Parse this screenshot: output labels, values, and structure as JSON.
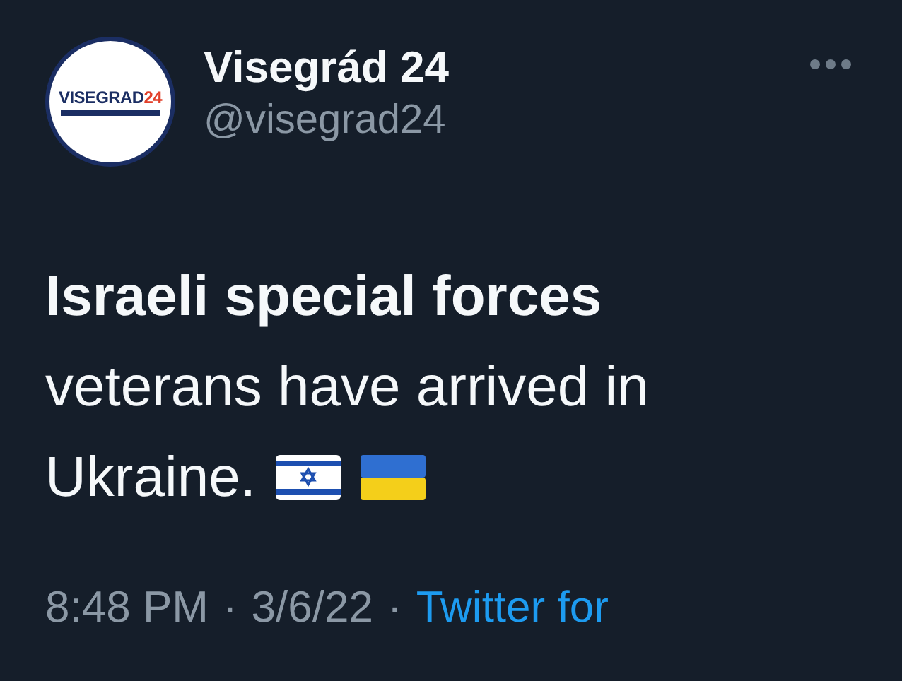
{
  "tweet": {
    "author": {
      "name": "Visegrád 24",
      "handle": "@visegrad24",
      "avatar": {
        "wordmark": "VISEGRAD",
        "number": "24"
      }
    },
    "headline": "Israeli special forces",
    "body_lines": [
      "veterans have arrived in",
      "Ukraine."
    ],
    "flags": [
      {
        "kind": "israel"
      },
      {
        "kind": "ukraine"
      }
    ],
    "meta": [
      {
        "kind": "text",
        "text": "8:48 PM"
      },
      {
        "kind": "separator",
        "text": "·"
      },
      {
        "kind": "text",
        "text": "3/6/22"
      },
      {
        "kind": "separator",
        "text": "·"
      },
      {
        "kind": "link",
        "text": "Twitter for"
      }
    ]
  }
}
